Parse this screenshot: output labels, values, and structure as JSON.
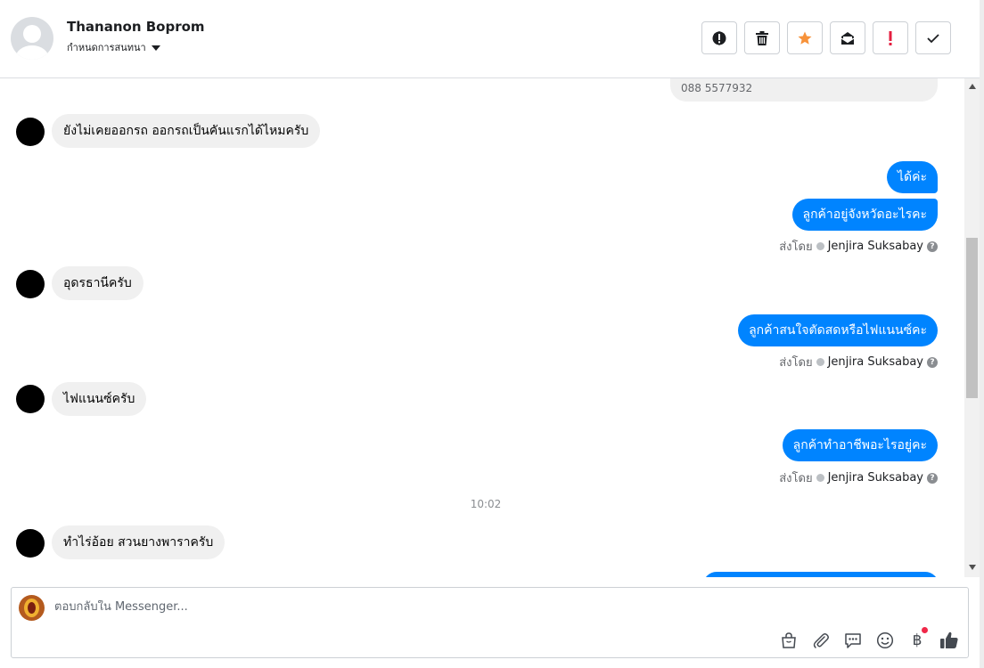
{
  "header": {
    "contact_name": "Thananon Boprom",
    "label_selector": "กำหนดการสนทนา",
    "actions": [
      {
        "id": "spam",
        "icon": "alert-circle-icon"
      },
      {
        "id": "delete",
        "icon": "trash-icon"
      },
      {
        "id": "star",
        "icon": "star-icon",
        "color": "#f7923a"
      },
      {
        "id": "mark-unread",
        "icon": "envelope-icon"
      },
      {
        "id": "important",
        "icon": "exclamation-icon",
        "color": "#e41e3f"
      },
      {
        "id": "done",
        "icon": "checkmark-icon"
      }
    ]
  },
  "thread": {
    "top_partial_text": "088 5577932",
    "messages": [
      {
        "direction": "in",
        "text": "ยังไม่เคยออกรถ ออกรถเป็นคันแรกได้ไหมครับ"
      },
      {
        "direction": "out",
        "text": "ได้ค่ะ"
      },
      {
        "direction": "out",
        "text": "ลูกค้าอยู่จังหวัดอะไรคะ"
      },
      {
        "direction": "meta",
        "sent_by_label": "ส่งโดย",
        "sender": "Jenjira Suksabay"
      },
      {
        "direction": "in",
        "text": "อุดรธานีครับ"
      },
      {
        "direction": "out",
        "text": "ลูกค้าสนใจตัดสดหรือไฟแนนซ์คะ"
      },
      {
        "direction": "meta",
        "sent_by_label": "ส่งโดย",
        "sender": "Jenjira Suksabay"
      },
      {
        "direction": "in",
        "text": "ไฟแนนซ์ครับ"
      },
      {
        "direction": "out",
        "text": "ลูกค้าทำอาชีพอะไรอยู่คะ"
      },
      {
        "direction": "meta",
        "sent_by_label": "ส่งโดย",
        "sender": "Jenjira Suksabay"
      },
      {
        "direction": "time",
        "text": "10:02"
      },
      {
        "direction": "in",
        "text": "ทำไร่อ้อย สวนยางพาราครับ"
      }
    ]
  },
  "composer": {
    "placeholder": "ตอบกลับใน Messenger...",
    "value": "",
    "tools": [
      "shopping-bag-icon",
      "paperclip-icon",
      "saved-replies-icon",
      "emoji-icon",
      "baht-icon",
      "thumbs-up-icon"
    ],
    "notification_color": "#f02849"
  },
  "colors": {
    "outgoing_bubble": "#0084ff",
    "incoming_bubble": "#f0f0f0",
    "border": "#ccd0d5"
  }
}
